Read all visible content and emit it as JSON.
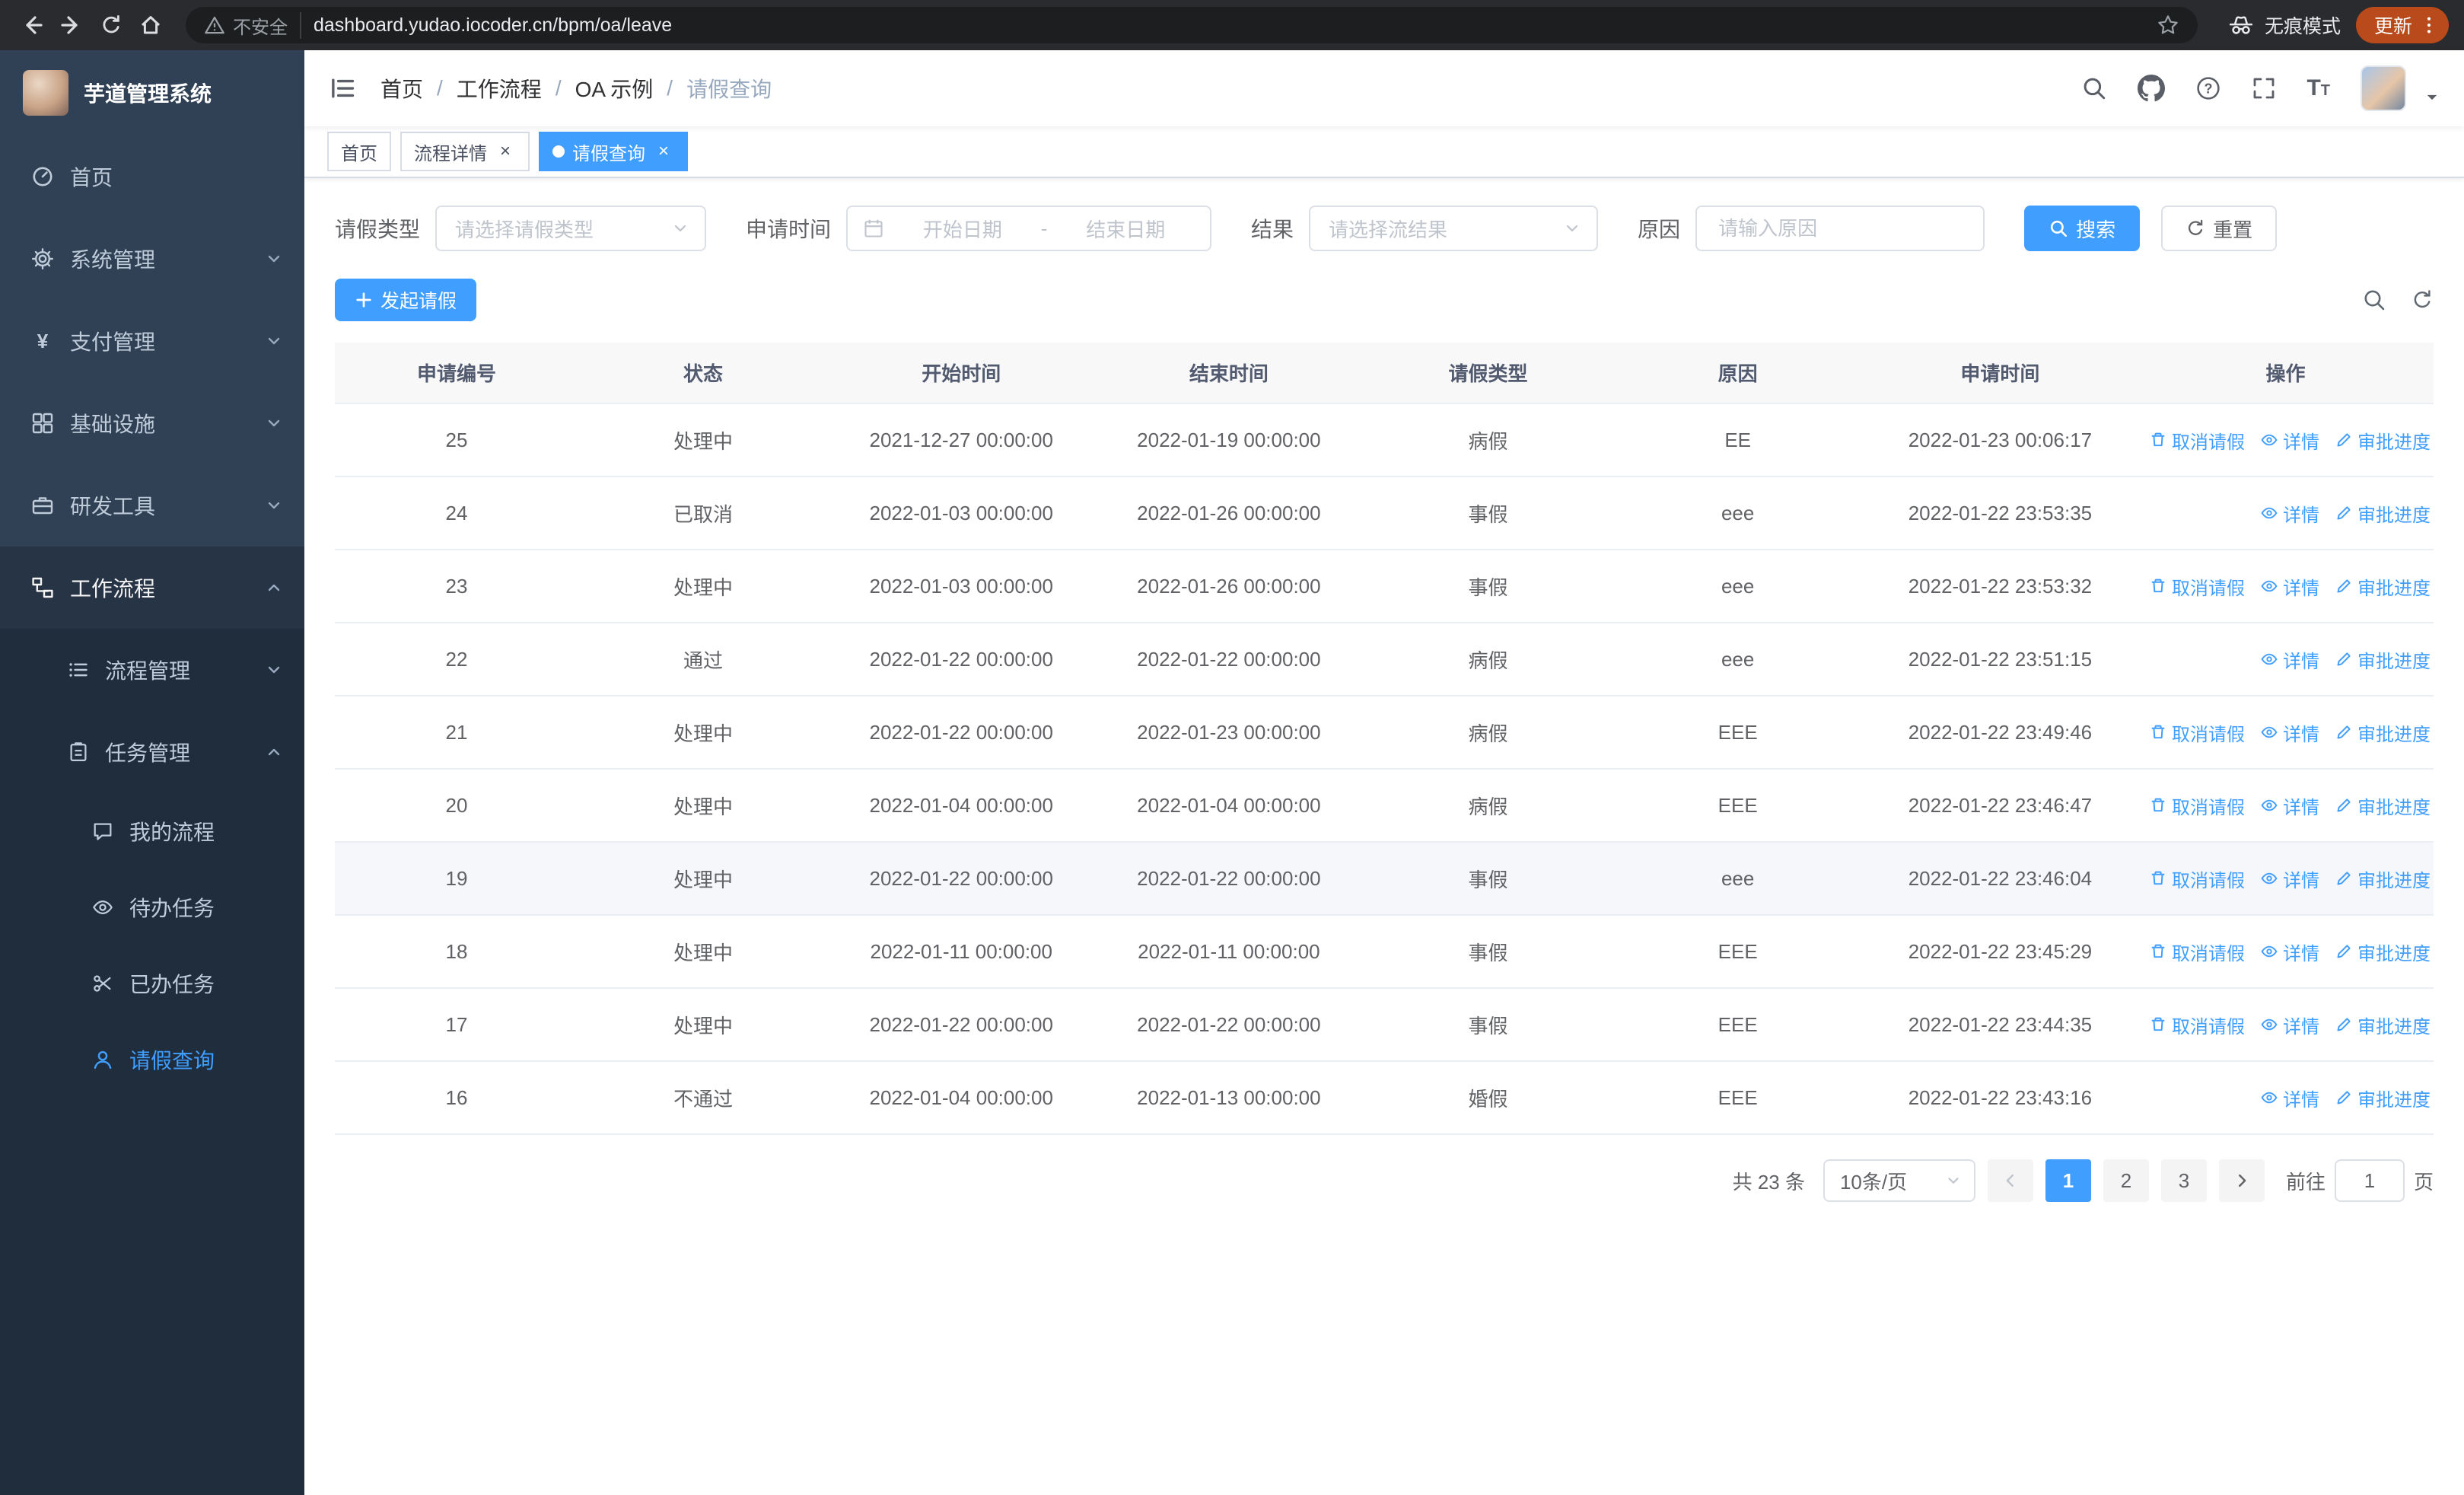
{
  "colors": {
    "accent": "#409eff",
    "sidebar_bg": "#304156",
    "submenu_bg": "#1f2d3d",
    "update_pill": "#b84a1b"
  },
  "browser": {
    "security_label": "不安全",
    "url": "dashboard.yudao.iocoder.cn/bpm/oa/leave",
    "incognito_label": "无痕模式",
    "update_label": "更新"
  },
  "sidebar": {
    "app_title": "芋道管理系统",
    "items": [
      {
        "label": "首页"
      },
      {
        "label": "系统管理"
      },
      {
        "label": "支付管理"
      },
      {
        "label": "基础设施"
      },
      {
        "label": "研发工具"
      },
      {
        "label": "工作流程"
      }
    ],
    "workflow_children": [
      {
        "label": "流程管理"
      },
      {
        "label": "任务管理"
      }
    ],
    "task_children": [
      {
        "label": "我的流程"
      },
      {
        "label": "待办任务"
      },
      {
        "label": "已办任务"
      },
      {
        "label": "请假查询"
      }
    ]
  },
  "header": {
    "breadcrumbs": [
      "首页",
      "工作流程",
      "OA 示例",
      "请假查询"
    ]
  },
  "tabs": [
    {
      "label": "首页"
    },
    {
      "label": "流程详情"
    },
    {
      "label": "请假查询"
    }
  ],
  "filters": {
    "leave_type_label": "请假类型",
    "leave_type_placeholder": "请选择请假类型",
    "apply_time_label": "申请时间",
    "start_date_placeholder": "开始日期",
    "range_separator": "-",
    "end_date_placeholder": "结束日期",
    "result_label": "结果",
    "result_placeholder": "请选择流结果",
    "reason_label": "原因",
    "reason_placeholder": "请输入原因",
    "search_label": "搜索",
    "reset_label": "重置"
  },
  "toolbar": {
    "create_label": "发起请假"
  },
  "table": {
    "columns": [
      "申请编号",
      "状态",
      "开始时间",
      "结束时间",
      "请假类型",
      "原因",
      "申请时间",
      "操作"
    ],
    "action_labels": {
      "cancel": "取消请假",
      "detail": "详情",
      "progress": "审批进度"
    },
    "rows": [
      {
        "id": "25",
        "status": "处理中",
        "start_time": "2021-12-27 00:00:00",
        "end_time": "2022-01-19 00:00:00",
        "leave_type": "病假",
        "reason": "EE",
        "apply_time": "2022-01-23 00:06:17",
        "actions": [
          "cancel",
          "detail",
          "progress"
        ]
      },
      {
        "id": "24",
        "status": "已取消",
        "start_time": "2022-01-03 00:00:00",
        "end_time": "2022-01-26 00:00:00",
        "leave_type": "事假",
        "reason": "eee",
        "apply_time": "2022-01-22 23:53:35",
        "actions": [
          "detail",
          "progress"
        ]
      },
      {
        "id": "23",
        "status": "处理中",
        "start_time": "2022-01-03 00:00:00",
        "end_time": "2022-01-26 00:00:00",
        "leave_type": "事假",
        "reason": "eee",
        "apply_time": "2022-01-22 23:53:32",
        "actions": [
          "cancel",
          "detail",
          "progress"
        ]
      },
      {
        "id": "22",
        "status": "通过",
        "start_time": "2022-01-22 00:00:00",
        "end_time": "2022-01-22 00:00:00",
        "leave_type": "病假",
        "reason": "eee",
        "apply_time": "2022-01-22 23:51:15",
        "actions": [
          "detail",
          "progress"
        ]
      },
      {
        "id": "21",
        "status": "处理中",
        "start_time": "2022-01-22 00:00:00",
        "end_time": "2022-01-23 00:00:00",
        "leave_type": "病假",
        "reason": "EEE",
        "apply_time": "2022-01-22 23:49:46",
        "actions": [
          "cancel",
          "detail",
          "progress"
        ]
      },
      {
        "id": "20",
        "status": "处理中",
        "start_time": "2022-01-04 00:00:00",
        "end_time": "2022-01-04 00:00:00",
        "leave_type": "病假",
        "reason": "EEE",
        "apply_time": "2022-01-22 23:46:47",
        "actions": [
          "cancel",
          "detail",
          "progress"
        ]
      },
      {
        "id": "19",
        "status": "处理中",
        "start_time": "2022-01-22 00:00:00",
        "end_time": "2022-01-22 00:00:00",
        "leave_type": "事假",
        "reason": "eee",
        "apply_time": "2022-01-22 23:46:04",
        "actions": [
          "cancel",
          "detail",
          "progress"
        ],
        "highlighted": true
      },
      {
        "id": "18",
        "status": "处理中",
        "start_time": "2022-01-11 00:00:00",
        "end_time": "2022-01-11 00:00:00",
        "leave_type": "事假",
        "reason": "EEE",
        "apply_time": "2022-01-22 23:45:29",
        "actions": [
          "cancel",
          "detail",
          "progress"
        ]
      },
      {
        "id": "17",
        "status": "处理中",
        "start_time": "2022-01-22 00:00:00",
        "end_time": "2022-01-22 00:00:00",
        "leave_type": "事假",
        "reason": "EEE",
        "apply_time": "2022-01-22 23:44:35",
        "actions": [
          "cancel",
          "detail",
          "progress"
        ]
      },
      {
        "id": "16",
        "status": "不通过",
        "start_time": "2022-01-04 00:00:00",
        "end_time": "2022-01-13 00:00:00",
        "leave_type": "婚假",
        "reason": "EEE",
        "apply_time": "2022-01-22 23:43:16",
        "actions": [
          "detail",
          "progress"
        ]
      }
    ]
  },
  "pagination": {
    "total_label": "共 23 条",
    "page_size_label": "10条/页",
    "pages": [
      "1",
      "2",
      "3"
    ],
    "active_page": "1",
    "goto_label": "前往",
    "goto_value": "1",
    "page_suffix": "页"
  }
}
